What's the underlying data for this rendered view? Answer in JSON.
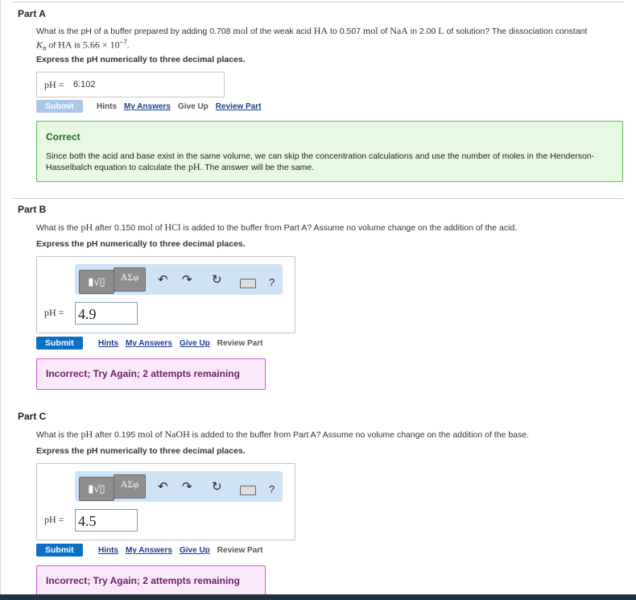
{
  "partA": {
    "title": "Part A",
    "question_pre": "What is the pH of a buffer prepared by adding 0.708 ",
    "mol": "mol",
    "question_mid1": " of the weak acid ",
    "HA": "HA",
    "question_mid2": " to 0.507 ",
    "question_mid3": " of ",
    "NaA": "NaA",
    "question_mid4": " in 2.00 ",
    "L": "L",
    "question_post": " of solution? The dissociation constant",
    "line2_Ka": "K",
    "line2_a": "a",
    "line2_mid": " of ",
    "line2_is": " is ",
    "line2_val": "5.66 × 10",
    "line2_exp": "−7",
    "line2_end": ".",
    "instruction": "Express the pH numerically to three decimal places.",
    "answer_label": "pH =",
    "answer_value": "6.102",
    "submit_label": "Submit",
    "links": {
      "hints": "Hints",
      "my_answers": "My Answers",
      "give_up": "Give Up",
      "review_part": "Review Part"
    },
    "feedback_title": "Correct",
    "feedback_text_1": "Since both the acid and base exist in the same volume, we can skip the concentration calculations and use the number of moles in the Henderson-Hasselbalch equation to calculate the ",
    "feedback_pH": "pH",
    "feedback_text_2": ". The answer will be the same."
  },
  "partB": {
    "title": "Part B",
    "question_pre": "What is the ",
    "pH": "pH",
    "question_mid1": " after 0.150 ",
    "mol": "mol",
    "question_mid2": " of ",
    "compound": "HCl",
    "question_post": " is added to the buffer from Part A? Assume no volume change on the addition of the acid.",
    "instruction": "Express the pH numerically to three decimal places.",
    "toolbar": {
      "template": "▮√▯",
      "greek": "ΑΣφ",
      "undo": "↶",
      "redo": "↷",
      "reset": "↻",
      "help": "?"
    },
    "answer_label": "pH =",
    "answer_value": "4.9",
    "submit_label": "Submit",
    "links": {
      "hints": "Hints",
      "my_answers": "My Answers",
      "give_up": "Give Up",
      "review_part": "Review Part"
    },
    "feedback": "Incorrect; Try Again; 2 attempts remaining"
  },
  "partC": {
    "title": "Part C",
    "question_pre": "What is the ",
    "pH": "pH",
    "question_mid1": " after 0.195 ",
    "mol": "mol",
    "question_mid2": " of ",
    "compound": "NaOH",
    "question_post": " is added to the buffer from Part A? Assume no volume change on the addition of the base.",
    "instruction": "Express the pH numerically to three decimal places.",
    "toolbar": {
      "template": "▮√▯",
      "greek": "ΑΣφ",
      "undo": "↶",
      "redo": "↷",
      "reset": "↻",
      "help": "?"
    },
    "answer_label": "pH =",
    "answer_value": "4.5",
    "submit_label": "Submit",
    "links": {
      "hints": "Hints",
      "my_answers": "My Answers",
      "give_up": "Give Up",
      "review_part": "Review Part"
    },
    "feedback": "Incorrect; Try Again; 2 attempts remaining"
  },
  "colors": {
    "submit_active": "#0b6fc6",
    "submit_disabled": "#a9c8e8",
    "correct_bg": "#e7f8e3",
    "correct_border": "#5cb85c",
    "incorrect_bg": "#fbe9fb",
    "incorrect_border": "#c95bc9",
    "toolbar_bg": "#cfe3f7"
  }
}
